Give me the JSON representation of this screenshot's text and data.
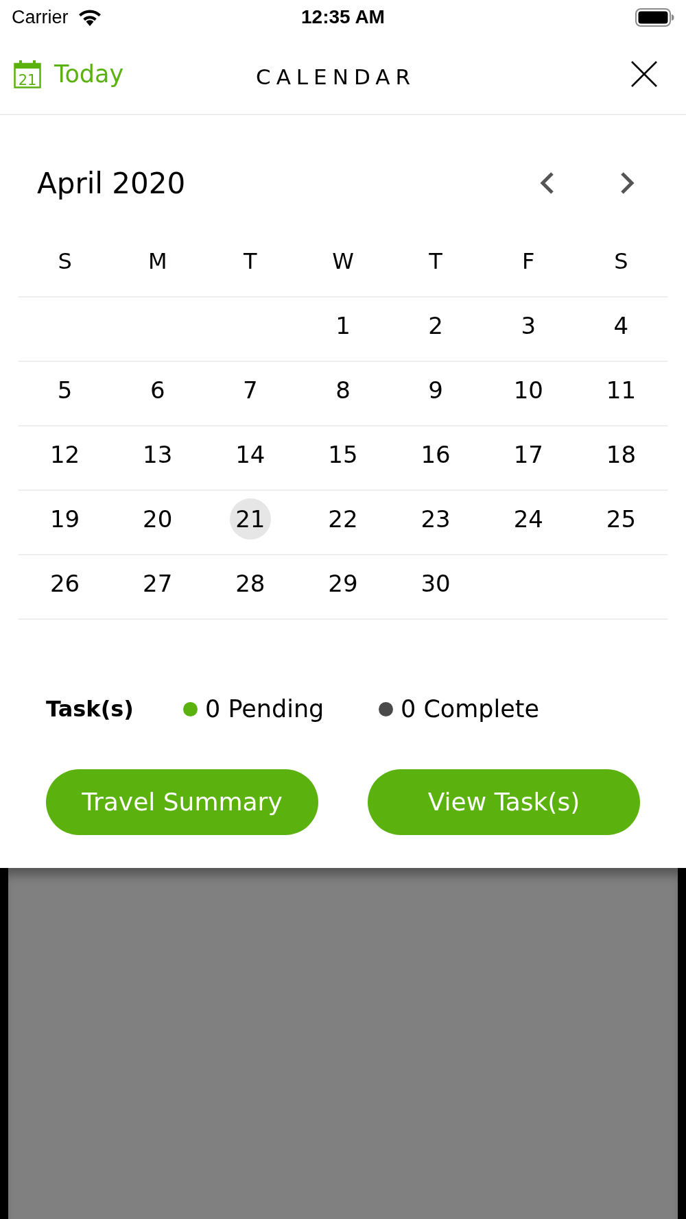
{
  "status_bar": {
    "carrier": "Carrier",
    "time": "12:35 AM"
  },
  "header": {
    "today": {
      "icon_day": "21",
      "label": "Today"
    },
    "title": "CALENDAR"
  },
  "calendar": {
    "month": "April 2020",
    "weekdays": [
      "S",
      "M",
      "T",
      "W",
      "T",
      "F",
      "S"
    ],
    "weeks": [
      [
        {
          "kind": "blank"
        },
        {
          "kind": "blank"
        },
        {
          "kind": "blank"
        },
        {
          "kind": "day",
          "label": "1",
          "selected": false
        },
        {
          "kind": "day",
          "label": "2",
          "selected": false
        },
        {
          "kind": "day",
          "label": "3",
          "selected": false
        },
        {
          "kind": "day",
          "label": "4",
          "selected": false
        }
      ],
      [
        {
          "kind": "day",
          "label": "5",
          "selected": false
        },
        {
          "kind": "day",
          "label": "6",
          "selected": false
        },
        {
          "kind": "day",
          "label": "7",
          "selected": false
        },
        {
          "kind": "day",
          "label": "8",
          "selected": false
        },
        {
          "kind": "day",
          "label": "9",
          "selected": false
        },
        {
          "kind": "day",
          "label": "10",
          "selected": false
        },
        {
          "kind": "day",
          "label": "11",
          "selected": false
        }
      ],
      [
        {
          "kind": "day",
          "label": "12",
          "selected": false
        },
        {
          "kind": "day",
          "label": "13",
          "selected": false
        },
        {
          "kind": "day",
          "label": "14",
          "selected": false
        },
        {
          "kind": "day",
          "label": "15",
          "selected": false
        },
        {
          "kind": "day",
          "label": "16",
          "selected": false
        },
        {
          "kind": "day",
          "label": "17",
          "selected": false
        },
        {
          "kind": "day",
          "label": "18",
          "selected": false
        }
      ],
      [
        {
          "kind": "day",
          "label": "19",
          "selected": false
        },
        {
          "kind": "day",
          "label": "20",
          "selected": false
        },
        {
          "kind": "day",
          "label": "21",
          "selected": true
        },
        {
          "kind": "day",
          "label": "22",
          "selected": false
        },
        {
          "kind": "day",
          "label": "23",
          "selected": false
        },
        {
          "kind": "day",
          "label": "24",
          "selected": false
        },
        {
          "kind": "day",
          "label": "25",
          "selected": false
        }
      ],
      [
        {
          "kind": "day",
          "label": "26",
          "selected": false
        },
        {
          "kind": "day",
          "label": "27",
          "selected": false
        },
        {
          "kind": "day",
          "label": "28",
          "selected": false
        },
        {
          "kind": "day",
          "label": "29",
          "selected": false
        },
        {
          "kind": "day",
          "label": "30",
          "selected": false
        },
        {
          "kind": "blank"
        },
        {
          "kind": "blank"
        }
      ]
    ]
  },
  "tasks": {
    "label": "Task(s)",
    "counts": [
      {
        "text": "0 Pending",
        "color": "#5bb10d"
      },
      {
        "text": "0 Complete",
        "color": "#4a4a4a"
      }
    ]
  },
  "buttons": [
    "Travel Summary",
    "View Task(s)"
  ]
}
